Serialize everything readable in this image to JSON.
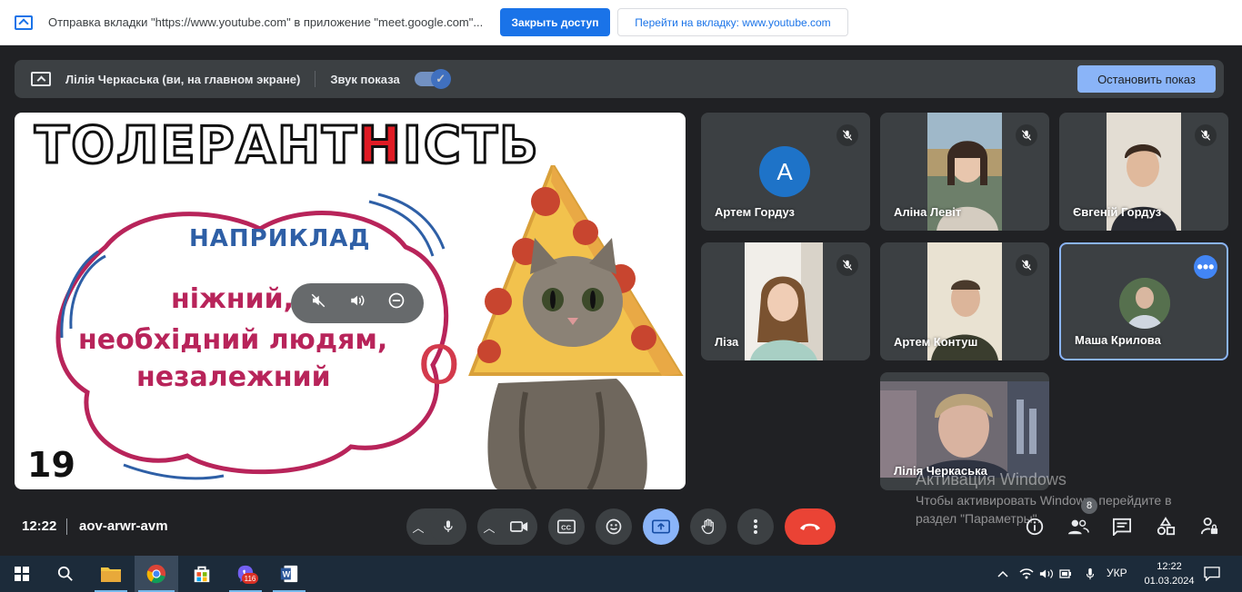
{
  "share_bar": {
    "text": "Отправка вкладки \"https://www.youtube.com\" в приложение \"meet.google.com\"...",
    "stop_button": "Закрыть доступ",
    "go_tab_button": "Перейти на вкладку: www.youtube.com"
  },
  "presenting": {
    "name": "Лілія Черкаська (ви, на главном экране)",
    "sound_label": "Звук показа",
    "stop_button": "Остановить показ"
  },
  "slide": {
    "title_before": "ТОЛЕРАНТ",
    "title_red": "Н",
    "title_after": "ІСТЬ",
    "example": "НАПРИКЛАД",
    "line1": "ніжний,",
    "line2": "необхідний людям,",
    "line3": "незалежний",
    "number": "19",
    "o_letter": "О"
  },
  "participants": [
    {
      "name": "Артем Гордуз",
      "avatar_letter": "А"
    },
    {
      "name": "Аліна Левіт"
    },
    {
      "name": "Євгеній Гордуз"
    },
    {
      "name": "Ліза"
    },
    {
      "name": "Артем Контуш"
    },
    {
      "name": "Маша Крилова"
    },
    {
      "name": "Лілія Черкаська"
    }
  ],
  "watermark": {
    "title": "Активация Windows",
    "subtitle": "Чтобы активировать Windows, перейдите в раздел \"Параметры\"."
  },
  "meeting": {
    "time": "12:22",
    "code": "aov-arwr-avm",
    "people_count": "8"
  },
  "taskbar": {
    "viber_badge": "116",
    "lang": "УКР",
    "time": "12:22",
    "date": "01.03.2024"
  },
  "colors": {
    "accent": "#1a73e8",
    "present_blue": "#8ab4f8",
    "end_call": "#ea4335",
    "slide_red": "#e01b24",
    "slide_magenta": "#b8245a",
    "slide_blue": "#2e5fa6"
  }
}
